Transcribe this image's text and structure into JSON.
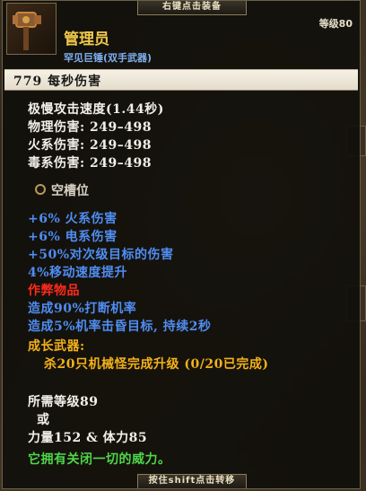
{
  "tooltip": {
    "top_hint": "右键点击装备",
    "bottom_hint": "按住shift点击转移",
    "item_name": "管理员",
    "item_type": "罕见巨锤(双手武器)",
    "level_label": "等级80",
    "dps": "779 每秒伤害",
    "stats": [
      "极慢攻击速度(1.44秒)",
      "物理伤害: 249–498",
      "火系伤害: 249–498",
      "毒系伤害: 249–498"
    ],
    "socket_label": "空槽位",
    "affixes": [
      "+6% 火系伤害",
      "+6% 电系伤害",
      "+50%对次级目标的伤害",
      "4%移动速度提升"
    ],
    "cursed": "作弊物品",
    "effects": [
      "造成90%打断机率",
      "造成5%机率击昏目标, 持续2秒"
    ],
    "growth_title": "成长武器:",
    "growth_desc": "杀20只机械怪完成升级 (0/20已完成)",
    "requirements": [
      "所需等级89",
      "或",
      "力量152 & 体力85"
    ],
    "flavor": "它拥有关闭一切的威力。"
  },
  "colors": {
    "name": "#f0c94a",
    "type": "#7fb0ef",
    "affix": "#4f8df2",
    "cursed": "#ff2a1e",
    "growth": "#f3b21a",
    "flavor": "#4fd54a"
  },
  "icons": {
    "item": "hammer-icon",
    "socket": "socket-ring-icon"
  }
}
